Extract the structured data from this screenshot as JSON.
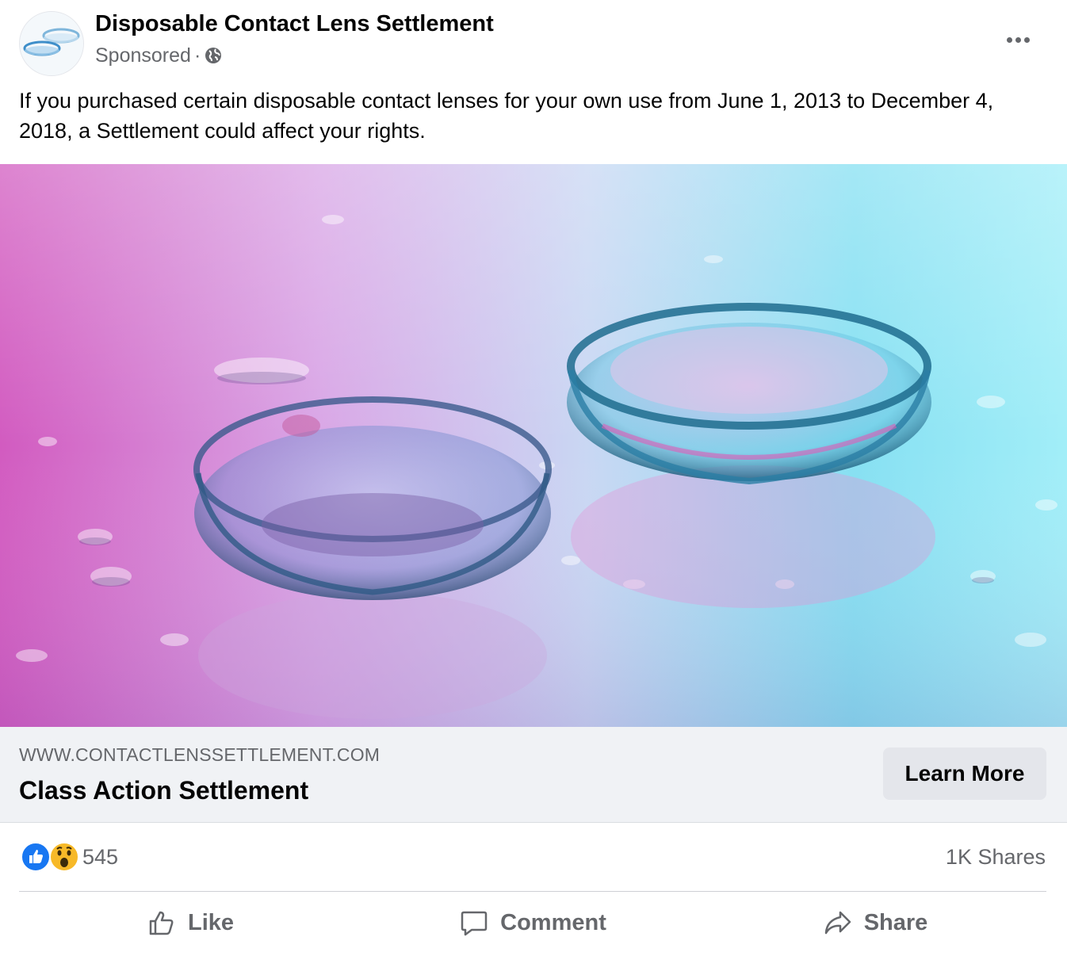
{
  "post": {
    "page_name": "Disposable Contact Lens Settlement",
    "sponsored_label": "Sponsored",
    "separator": "·",
    "privacy_icon": "globe-icon",
    "more_icon": "more-horizontal-icon",
    "body_text": "If you purchased certain disposable contact lenses for your own use from June 1, 2013 to December 4, 2018, a Settlement could affect your rights."
  },
  "link_preview": {
    "url": "WWW.CONTACTLENSSETTLEMENT.COM",
    "title": "Class Action Settlement",
    "cta_label": "Learn More"
  },
  "engagement": {
    "reactions": [
      "like-reaction-icon",
      "wow-reaction-icon"
    ],
    "reaction_count": "545",
    "shares": "1K Shares"
  },
  "actions": {
    "like": "Like",
    "comment": "Comment",
    "share": "Share"
  },
  "colors": {
    "primary_text": "#050505",
    "secondary_text": "#65676b",
    "like_blue": "#1877f2",
    "wow_yellow": "#f7b928",
    "link_bar_bg": "#f0f2f5",
    "button_bg": "#e4e6eb"
  }
}
